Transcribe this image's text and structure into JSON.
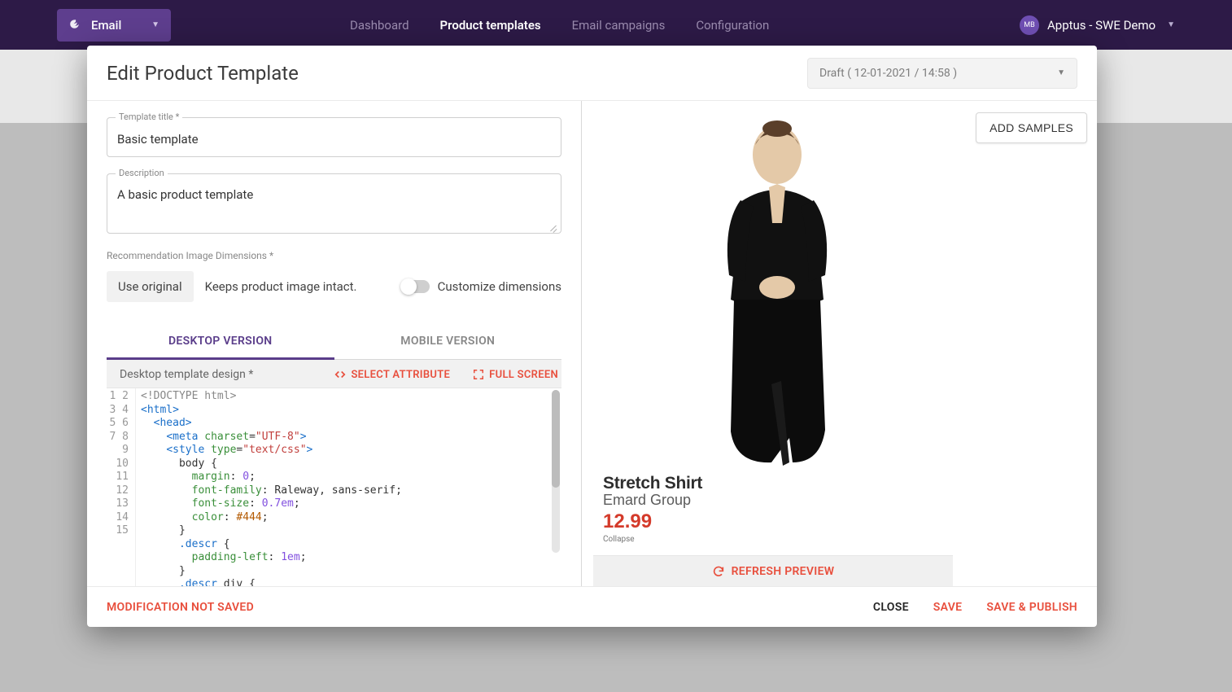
{
  "topbar": {
    "email_label": "Email",
    "nav": [
      "Dashboard",
      "Product templates",
      "Email campaigns",
      "Configuration"
    ],
    "nav_active_index": 1,
    "avatar_initials": "MB",
    "account_label": "Apptus - SWE Demo"
  },
  "modal": {
    "title": "Edit Product Template",
    "draft_label": "Draft ( 12-01-2021 / 14:58 )",
    "fields": {
      "title_label": "Template title *",
      "title_value": "Basic template",
      "desc_label": "Description",
      "desc_value": "A basic product template",
      "dim_label": "Recommendation Image Dimensions *",
      "use_original": "Use original",
      "use_original_desc": "Keeps product image intact.",
      "customize_label": "Customize dimensions"
    },
    "tabs": {
      "desktop": "DESKTOP VERSION",
      "mobile": "MOBILE VERSION"
    },
    "editor": {
      "design_label": "Desktop template design *",
      "select_attr": "SELECT ATTRIBUTE",
      "full_screen": "FULL SCREEN",
      "line_count": 15
    },
    "preview": {
      "name": "Stretch Shirt",
      "brand": "Emard Group",
      "price": "12.99",
      "collapse": "Collapse",
      "refresh": "REFRESH PREVIEW"
    },
    "samples_btn": "ADD SAMPLES",
    "footer": {
      "warn": "MODIFICATION NOT SAVED",
      "close": "CLOSE",
      "save": "SAVE",
      "publish": "SAVE & PUBLISH"
    }
  }
}
